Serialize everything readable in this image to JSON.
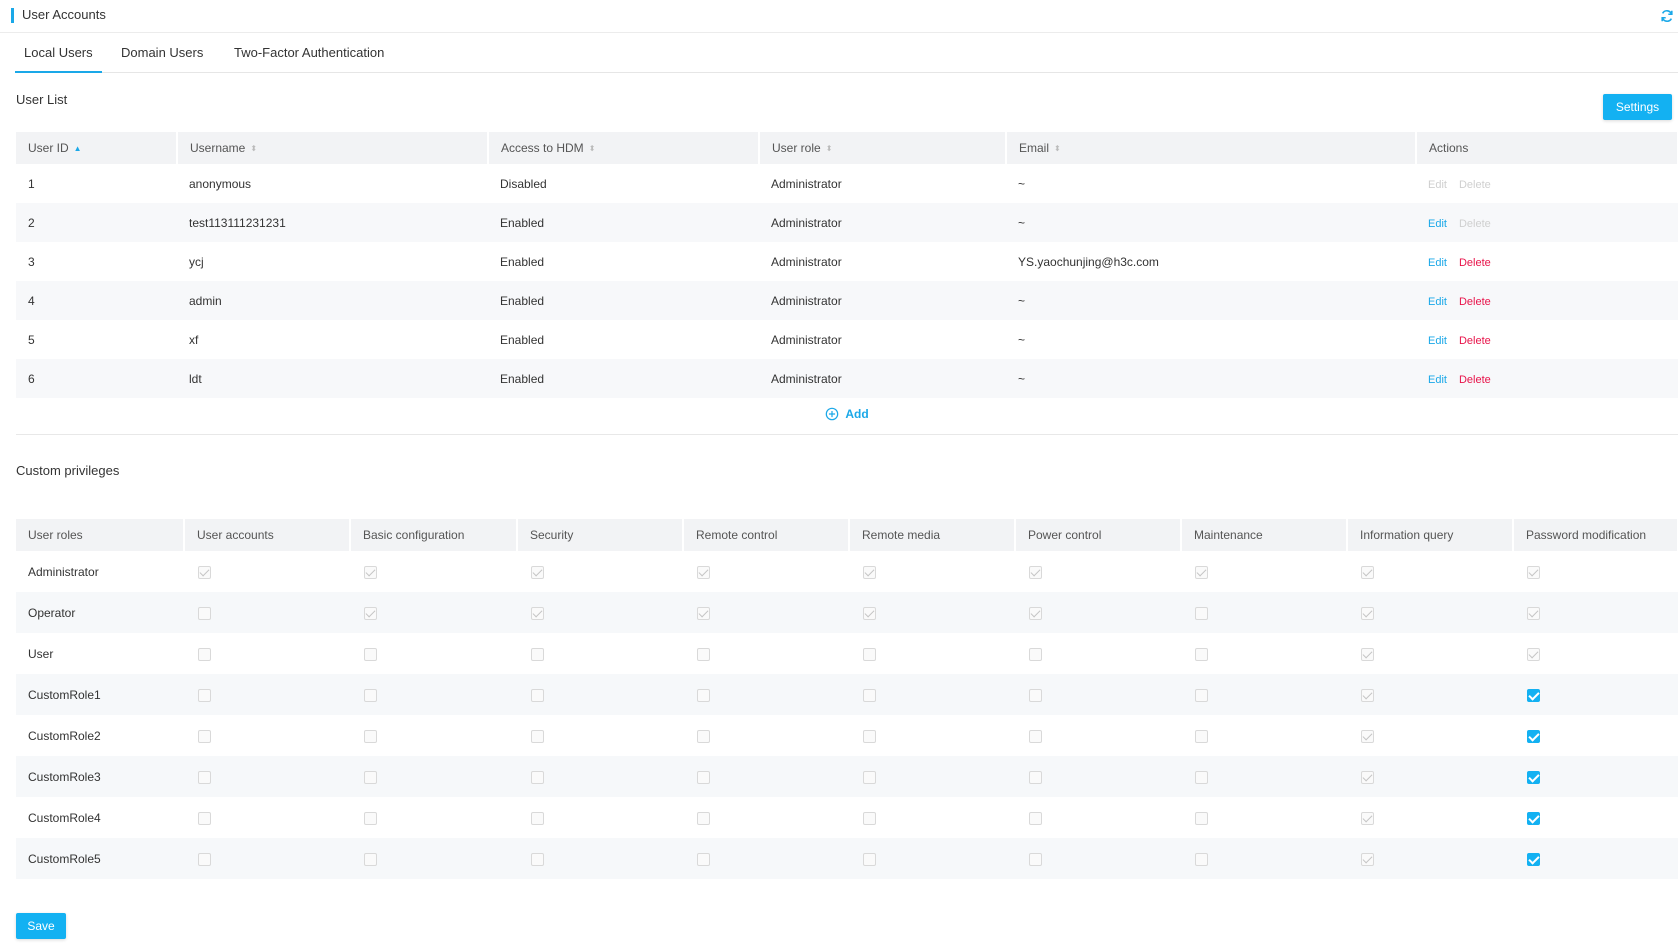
{
  "header": {
    "title": "User Accounts",
    "refresh_icon": "refresh-icon",
    "accent": "#1aa8e8"
  },
  "tabs": [
    {
      "label": "Local Users",
      "active": true
    },
    {
      "label": "Domain Users",
      "active": false
    },
    {
      "label": "Two-Factor Authentication",
      "active": false
    }
  ],
  "user_list": {
    "title": "User List",
    "settings_label": "Settings",
    "columns": [
      "User ID",
      "Username",
      "Access to HDM",
      "User role",
      "Email",
      "Actions"
    ],
    "rows": [
      {
        "id": "1",
        "username": "anonymous",
        "access": "Disabled",
        "role": "Administrator",
        "email": "~",
        "edit": "Edit",
        "delete": "Delete",
        "edit_enabled": false,
        "delete_enabled": false
      },
      {
        "id": "2",
        "username": "test113111231231",
        "access": "Enabled",
        "role": "Administrator",
        "email": "~",
        "edit": "Edit",
        "delete": "Delete",
        "edit_enabled": true,
        "delete_enabled": false
      },
      {
        "id": "3",
        "username": "ycj",
        "access": "Enabled",
        "role": "Administrator",
        "email": "YS.yaochunjing@h3c.com",
        "edit": "Edit",
        "delete": "Delete",
        "edit_enabled": true,
        "delete_enabled": true
      },
      {
        "id": "4",
        "username": "admin",
        "access": "Enabled",
        "role": "Administrator",
        "email": "~",
        "edit": "Edit",
        "delete": "Delete",
        "edit_enabled": true,
        "delete_enabled": true
      },
      {
        "id": "5",
        "username": "xf",
        "access": "Enabled",
        "role": "Administrator",
        "email": "~",
        "edit": "Edit",
        "delete": "Delete",
        "edit_enabled": true,
        "delete_enabled": true
      },
      {
        "id": "6",
        "username": "ldt",
        "access": "Enabled",
        "role": "Administrator",
        "email": "~",
        "edit": "Edit",
        "delete": "Delete",
        "edit_enabled": true,
        "delete_enabled": true
      }
    ],
    "add_label": "Add"
  },
  "privileges": {
    "title": "Custom privileges",
    "columns": [
      "User roles",
      "User accounts",
      "Basic configuration",
      "Security",
      "Remote control",
      "Remote media",
      "Power control",
      "Maintenance",
      "Information query",
      "Password modification"
    ],
    "rows": [
      {
        "role": "Administrator",
        "states": [
          "cd",
          "cd",
          "cd",
          "cd",
          "cd",
          "cd",
          "cd",
          "cd",
          "cd"
        ]
      },
      {
        "role": "Operator",
        "states": [
          "u",
          "cd",
          "cd",
          "cd",
          "cd",
          "cd",
          "u",
          "cd",
          "cd"
        ]
      },
      {
        "role": "User",
        "states": [
          "u",
          "u",
          "u",
          "u",
          "u",
          "u",
          "u",
          "cd",
          "cd"
        ]
      },
      {
        "role": "CustomRole1",
        "states": [
          "u",
          "u",
          "u",
          "u",
          "u",
          "u",
          "u",
          "cd",
          "c"
        ]
      },
      {
        "role": "CustomRole2",
        "states": [
          "u",
          "u",
          "u",
          "u",
          "u",
          "u",
          "u",
          "cd",
          "c"
        ]
      },
      {
        "role": "CustomRole3",
        "states": [
          "u",
          "u",
          "u",
          "u",
          "u",
          "u",
          "u",
          "cd",
          "c"
        ]
      },
      {
        "role": "CustomRole4",
        "states": [
          "u",
          "u",
          "u",
          "u",
          "u",
          "u",
          "u",
          "cd",
          "c"
        ]
      },
      {
        "role": "CustomRole5",
        "states": [
          "u",
          "u",
          "u",
          "u",
          "u",
          "u",
          "u",
          "cd",
          "c"
        ]
      }
    ]
  },
  "save_label": "Save",
  "colors": {
    "primary": "#13b1f2",
    "danger": "#e8134a",
    "disabled": "#cfcfcf"
  }
}
